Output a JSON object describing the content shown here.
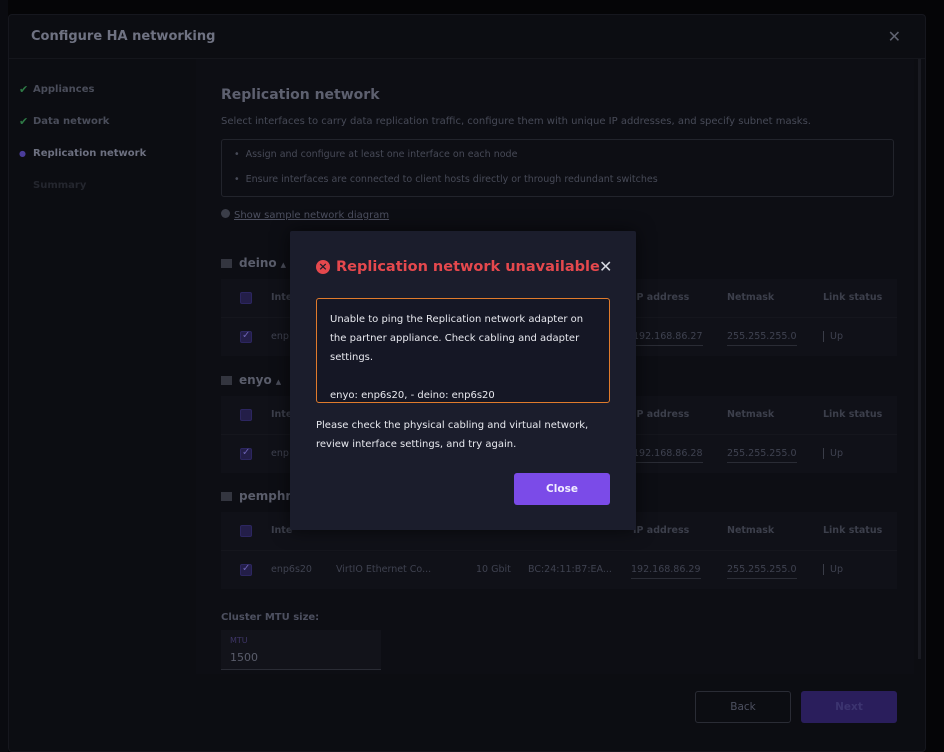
{
  "wizard": {
    "title": "Configure HA networking",
    "steps": [
      {
        "label": "Appliances",
        "state": "done"
      },
      {
        "label": "Data network",
        "state": "done"
      },
      {
        "label": "Replication network",
        "state": "active"
      },
      {
        "label": "Summary",
        "state": "future"
      }
    ],
    "section_title": "Replication network",
    "section_description": "Select interfaces to carry data replication traffic, configure them with unique IP addresses, and specify subnet masks.",
    "info_items": [
      "Assign and configure at least one interface on each node",
      "Ensure interfaces are connected to client hosts directly or through redundant switches"
    ],
    "diagram_link": "Show sample network diagram",
    "columns": {
      "interface": "Inte",
      "ip": "IP address",
      "netmask": "Netmask",
      "link_status": "Link status"
    },
    "nodes": [
      {
        "name": "deino",
        "iface": "enp",
        "ip": "192.168.86.27",
        "netmask": "255.255.255.0",
        "status": "Up"
      },
      {
        "name": "enyo",
        "iface": "enp",
        "ip": "192.168.86.28",
        "netmask": "255.255.255.0",
        "status": "Up"
      },
      {
        "name": "pemphre",
        "iface": "enp6s20",
        "type": "VirtIO Ethernet Co...",
        "speed": "10 Gbit",
        "mac": "BC:24:11:B7:EA...",
        "ip": "192.168.86.29",
        "netmask": "255.255.255.0",
        "status": "Up"
      }
    ],
    "mtu_label": "Cluster MTU size:",
    "mtu_caption": "MTU",
    "mtu_value": "1500",
    "back_label": "Back",
    "next_label": "Next"
  },
  "modal": {
    "title": "Replication network unavailable",
    "error_message": "Unable to ping the Replication network adapter on the partner appliance. Check cabling and adapter settings.",
    "error_detail": "enyo: enp6s20, - deino: enp6s20",
    "advice": "Please check the physical cabling and virtual network, review interface settings, and try again.",
    "close_label": "Close"
  },
  "colors": {
    "error": "#e5484d",
    "accent": "#7b4be8",
    "warning_border": "#e07b2c",
    "success": "#2f7a46"
  },
  "icons": {
    "wizard_close": "close-icon",
    "modal_close": "close-icon",
    "modal_error": "error-circle-icon",
    "done": "check-icon",
    "info": "info-icon",
    "node": "server-icon"
  }
}
